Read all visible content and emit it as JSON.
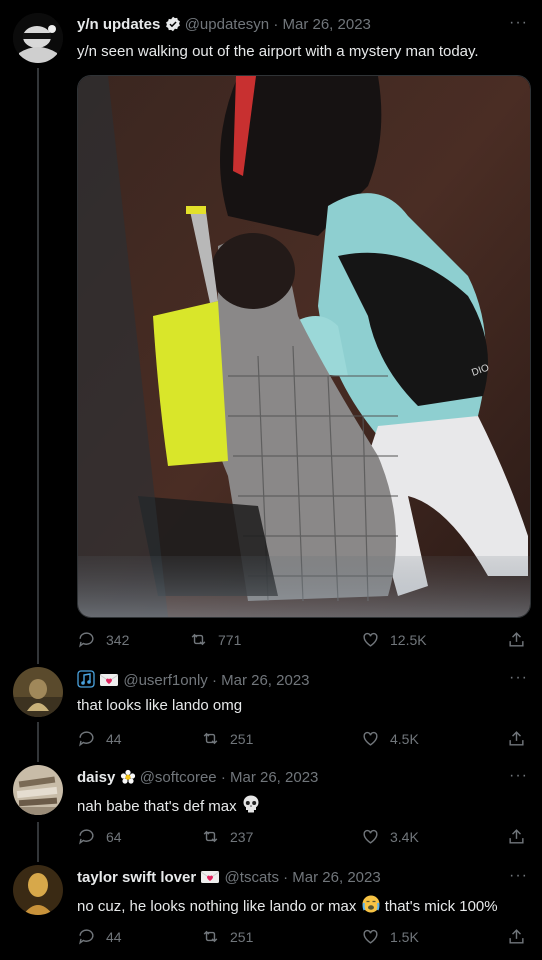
{
  "tweets": [
    {
      "name": "y/n updates",
      "handle": "@updatesyn",
      "date": "Mar 26, 2023",
      "text": "y/n seen walking out of the airport with a mystery man today.",
      "replies": "342",
      "retweets": "771",
      "likes": "12.5K"
    },
    {
      "name": "",
      "handle": "@userf1only",
      "date": "Mar 26, 2023",
      "text": "that looks like lando omg",
      "replies": "44",
      "retweets": "251",
      "likes": "4.5K"
    },
    {
      "name": "daisy",
      "handle": "@softcoree",
      "date": "Mar 26, 2023",
      "text": "nah babe that's def max",
      "replies": "64",
      "retweets": "237",
      "likes": "3.4K"
    },
    {
      "name": "taylor swift lover",
      "handle": "@tscats",
      "date": "Mar 26, 2023",
      "text": "no cuz, he looks nothing like lando or max",
      "text_after": "that's mick 100%",
      "replies": "44",
      "retweets": "251",
      "likes": "1.5K"
    }
  ],
  "separator": "·",
  "more_label": "···",
  "icons": [
    "verified-badge-icon",
    "reply-icon",
    "retweet-icon",
    "like-icon",
    "share-icon",
    "more-icon",
    "skull-emoji",
    "crying-emoji",
    "heart-letter-emoji",
    "flower-emoji",
    "music-note-emoji"
  ],
  "colors": {
    "background": "#000000",
    "text": "#e7e9ea",
    "muted": "#71767b",
    "verified": "#1d9bf0"
  }
}
